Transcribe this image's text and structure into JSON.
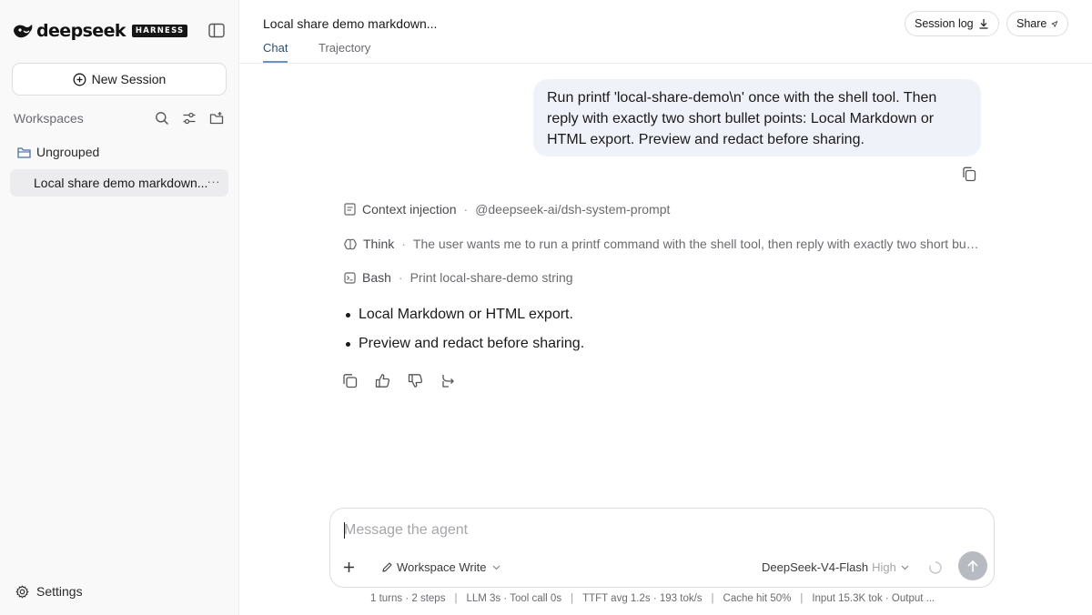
{
  "brand": {
    "name": "deepseek",
    "badge": "HARNESS"
  },
  "sidebar": {
    "new_session_label": "New Session",
    "workspaces_label": "Workspaces",
    "groups": [
      {
        "label": "Ungrouped",
        "sessions": [
          {
            "label": "Local share demo markdown..."
          }
        ]
      }
    ],
    "settings_label": "Settings"
  },
  "header": {
    "title": "Local share demo markdown...",
    "tabs": [
      {
        "label": "Chat",
        "active": true
      },
      {
        "label": "Trajectory",
        "active": false
      }
    ],
    "session_log_label": "Session log",
    "share_label": "Share"
  },
  "conversation": {
    "user_message": "Run printf 'local-share-demo\\n' once with the shell tool. Then reply with exactly two short bullet points: Local Markdown or HTML export. Preview and redact before sharing.",
    "steps": [
      {
        "name": "Context injection",
        "separator": "·",
        "detail": "@deepseek-ai/dsh-system-prompt",
        "icon": "document-icon"
      },
      {
        "name": "Think",
        "separator": "·",
        "detail": "The user wants me to run a printf command with the shell tool, then reply with exactly two short bullet points. Local Markdown or HTML export. Preview and redact before sharing.",
        "icon": "brain-icon"
      },
      {
        "name": "Bash",
        "separator": "·",
        "detail": "Print local-share-demo string",
        "icon": "terminal-icon"
      }
    ],
    "assistant_bullets": [
      "Local Markdown or HTML export.",
      "Preview and redact before sharing."
    ]
  },
  "composer": {
    "placeholder": "Message the agent",
    "mode_label": "Workspace Write",
    "model_label": "DeepSeek-V4-Flash",
    "effort_label": "High"
  },
  "status": {
    "turns": "1 turns · 2 steps",
    "timing": "LLM 3s · Tool call 0s",
    "throughput": "TTFT avg 1.2s · 193 tok/s",
    "cache": "Cache hit 50%",
    "tokens": "Input 15.3K tok · Output ..."
  },
  "colors": {
    "accent": "#6b92c0",
    "bubble": "#eff2f8",
    "send": "#b8bac1"
  }
}
